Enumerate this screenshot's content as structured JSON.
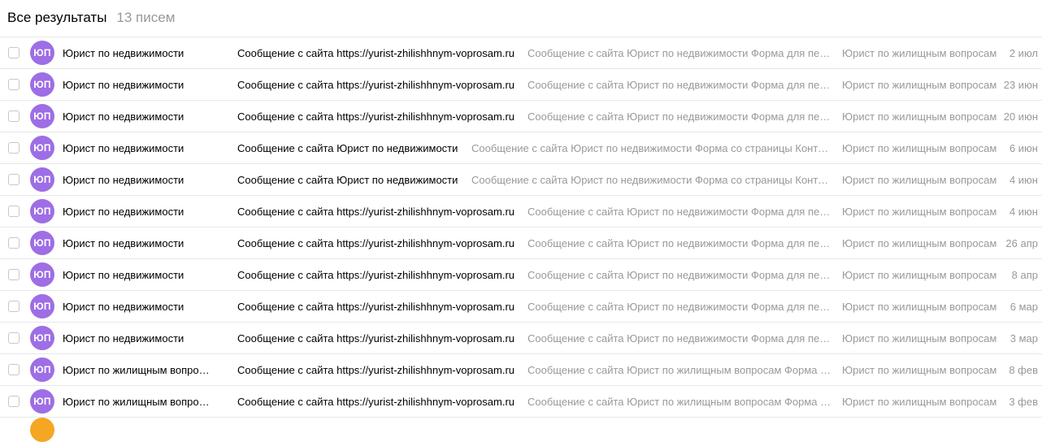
{
  "colors": {
    "avatar": "#9d6ee5",
    "peek_avatar": "#f5a623"
  },
  "header": {
    "title": "Все результаты",
    "count": "13 писем"
  },
  "emails": [
    {
      "initials": "ЮП",
      "sender": "Юрист по недвижимости",
      "subject": "Сообщение с сайта https://yurist-zhilishhnym-voprosam.ru",
      "snippet": "Сообщение с сайта Юрист по недвижимости Форма для пе…",
      "folder": "Юрист по жилищным вопросам",
      "date": "2 июл"
    },
    {
      "initials": "ЮП",
      "sender": "Юрист по недвижимости",
      "subject": "Сообщение с сайта https://yurist-zhilishhnym-voprosam.ru",
      "snippet": "Сообщение с сайта Юрист по недвижимости Форма для пе…",
      "folder": "Юрист по жилищным вопросам",
      "date": "23 июн"
    },
    {
      "initials": "ЮП",
      "sender": "Юрист по недвижимости",
      "subject": "Сообщение с сайта https://yurist-zhilishhnym-voprosam.ru",
      "snippet": "Сообщение с сайта Юрист по недвижимости Форма для пе…",
      "folder": "Юрист по жилищным вопросам",
      "date": "20 июн"
    },
    {
      "initials": "ЮП",
      "sender": "Юрист по недвижимости",
      "subject": "Сообщение с сайта Юрист по недвижимости",
      "snippet": "Сообщение с сайта Юрист по недвижимости Форма со страницы Конта…",
      "folder": "Юрист по жилищным вопросам",
      "date": "6 июн"
    },
    {
      "initials": "ЮП",
      "sender": "Юрист по недвижимости",
      "subject": "Сообщение с сайта Юрист по недвижимости",
      "snippet": "Сообщение с сайта Юрист по недвижимости Форма со страницы Конта…",
      "folder": "Юрист по жилищным вопросам",
      "date": "4 июн"
    },
    {
      "initials": "ЮП",
      "sender": "Юрист по недвижимости",
      "subject": "Сообщение с сайта https://yurist-zhilishhnym-voprosam.ru",
      "snippet": "Сообщение с сайта Юрист по недвижимости Форма для пе…",
      "folder": "Юрист по жилищным вопросам",
      "date": "4 июн"
    },
    {
      "initials": "ЮП",
      "sender": "Юрист по недвижимости",
      "subject": "Сообщение с сайта https://yurist-zhilishhnym-voprosam.ru",
      "snippet": "Сообщение с сайта Юрист по недвижимости Форма для пе…",
      "folder": "Юрист по жилищным вопросам",
      "date": "26 апр"
    },
    {
      "initials": "ЮП",
      "sender": "Юрист по недвижимости",
      "subject": "Сообщение с сайта https://yurist-zhilishhnym-voprosam.ru",
      "snippet": "Сообщение с сайта Юрист по недвижимости Форма для пе…",
      "folder": "Юрист по жилищным вопросам",
      "date": "8 апр"
    },
    {
      "initials": "ЮП",
      "sender": "Юрист по недвижимости",
      "subject": "Сообщение с сайта https://yurist-zhilishhnym-voprosam.ru",
      "snippet": "Сообщение с сайта Юрист по недвижимости Форма для пе…",
      "folder": "Юрист по жилищным вопросам",
      "date": "6 мар"
    },
    {
      "initials": "ЮП",
      "sender": "Юрист по недвижимости",
      "subject": "Сообщение с сайта https://yurist-zhilishhnym-voprosam.ru",
      "snippet": "Сообщение с сайта Юрист по недвижимости Форма для пе…",
      "folder": "Юрист по жилищным вопросам",
      "date": "3 мар"
    },
    {
      "initials": "ЮП",
      "sender": "Юрист по жилищным вопросам",
      "subject": "Сообщение с сайта https://yurist-zhilishhnym-voprosam.ru",
      "snippet": "Сообщение с сайта Юрист по жилищным вопросам Форма …",
      "folder": "Юрист по жилищным вопросам",
      "date": "8 фев"
    },
    {
      "initials": "ЮП",
      "sender": "Юрист по жилищным вопросам",
      "subject": "Сообщение с сайта https://yurist-zhilishhnym-voprosam.ru",
      "snippet": "Сообщение с сайта Юрист по жилищным вопросам Форма …",
      "folder": "Юрист по жилищным вопросам",
      "date": "3 фев"
    }
  ]
}
